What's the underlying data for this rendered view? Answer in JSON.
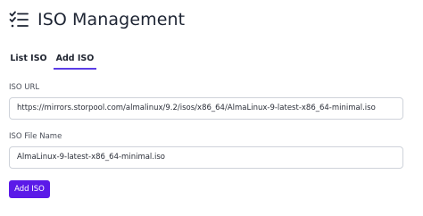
{
  "header": {
    "title": "ISO Management",
    "icon": "task-list-icon"
  },
  "tabs": [
    {
      "label": "List ISO",
      "active": false
    },
    {
      "label": "Add ISO",
      "active": true
    }
  ],
  "form": {
    "iso_url": {
      "label": "ISO URL",
      "value": "https://mirrors.storpool.com/almalinux/9.2/isos/x86_64/AlmaLinux-9-latest-x86_64-minimal.iso"
    },
    "iso_file_name": {
      "label": "ISO File Name",
      "value": "AlmaLinux-9-latest-x86_64-minimal.iso"
    },
    "submit_label": "Add ISO"
  },
  "colors": {
    "accent": "#5b3de6",
    "button": "#5b1ae8"
  }
}
